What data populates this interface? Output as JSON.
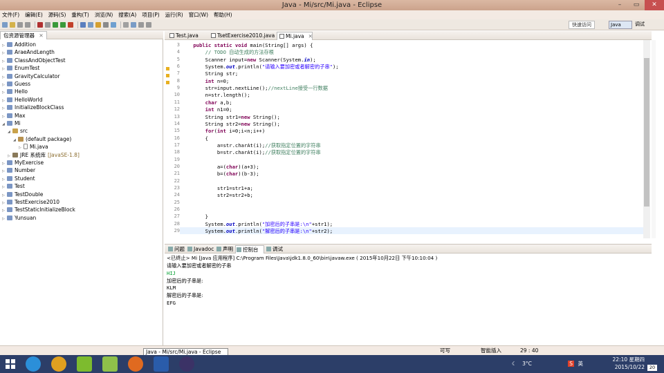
{
  "window": {
    "title": "Java - Mi/src/Mi.java - Eclipse"
  },
  "menu": [
    "文件(F)",
    "编辑(E)",
    "源码(S)",
    "重构(T)",
    "浏览(N)",
    "搜索(A)",
    "项目(P)",
    "运行(R)",
    "窗口(W)",
    "帮助(H)"
  ],
  "toolbar": {
    "quick_access": "快速访问",
    "perspectives": [
      "Java",
      "调试"
    ]
  },
  "explorer": {
    "title": "包资源管理器",
    "items": [
      {
        "label": "Addition",
        "level": 0,
        "twisty": "▷"
      },
      {
        "label": "AraeAndLength",
        "level": 0,
        "twisty": "▷"
      },
      {
        "label": "ClassAndObjectTest",
        "level": 0,
        "twisty": "▷"
      },
      {
        "label": "EnumTest",
        "level": 0,
        "twisty": "▷"
      },
      {
        "label": "GravityCalculator",
        "level": 0,
        "twisty": "▷"
      },
      {
        "label": "Guess",
        "level": 0,
        "twisty": "▷"
      },
      {
        "label": "Hello",
        "level": 0,
        "twisty": "▷"
      },
      {
        "label": "HelloWorld",
        "level": 0,
        "twisty": "▷"
      },
      {
        "label": "InitializeBlockClass",
        "level": 0,
        "twisty": "▷"
      },
      {
        "label": "Max",
        "level": 0,
        "twisty": "▷"
      },
      {
        "label": "Mi",
        "level": 0,
        "twisty": "◢"
      },
      {
        "label": "src",
        "level": 1,
        "twisty": "◢",
        "kind": "src"
      },
      {
        "label": "(default package)",
        "level": 2,
        "twisty": "◢",
        "kind": "pkg"
      },
      {
        "label": "Mi.java",
        "level": 3,
        "twisty": "▷",
        "kind": "file"
      },
      {
        "label": "JRE 系统库",
        "level": 1,
        "twisty": "▷",
        "kind": "lib",
        "decoration": "[JavaSE-1.8]"
      },
      {
        "label": "MyExercise",
        "level": 0,
        "twisty": "▷"
      },
      {
        "label": "Number",
        "level": 0,
        "twisty": "▷"
      },
      {
        "label": "Student",
        "level": 0,
        "twisty": "▷"
      },
      {
        "label": "Test",
        "level": 0,
        "twisty": "▷"
      },
      {
        "label": "TestDouble",
        "level": 0,
        "twisty": "▷"
      },
      {
        "label": "TestExercise2010",
        "level": 0,
        "twisty": "▷"
      },
      {
        "label": "TestStaticInitializeBlock",
        "level": 0,
        "twisty": "▷"
      },
      {
        "label": "Yunsuan",
        "level": 0,
        "twisty": "▷"
      }
    ]
  },
  "editor": {
    "tabs": [
      "Test.java",
      "TsetExercise2010.java",
      "Mi.java"
    ],
    "active_tab": 2,
    "cursor_line": 29,
    "lines": [
      {
        "n": "3",
        "html": "    <span class=\"kw\">public</span> <span class=\"kw\">static</span> <span class=\"kw\">void</span> main(String[] args) {"
      },
      {
        "n": "4",
        "html": "        <span class=\"cm\">// TODO 自动生成的方法存根</span>"
      },
      {
        "n": "5",
        "html": "        Scanner input=<span class=\"kw\">new</span> Scanner(System.<span class=\"fd\">in</span>);"
      },
      {
        "n": "6",
        "html": "        System.<span class=\"fd\">out</span>.println(<span class=\"st\">\"请输入要加密或者解密的子串\"</span>);"
      },
      {
        "n": "7",
        "html": "        String str;"
      },
      {
        "n": "8",
        "html": "        <span class=\"kw\">int</span> n=0;"
      },
      {
        "n": "9",
        "html": "        str=input.nextLine();<span class=\"cm\">//nextLine接受一行数据</span>"
      },
      {
        "n": "10",
        "html": "        n=str.length();"
      },
      {
        "n": "11",
        "html": "        <span class=\"kw\">char</span> a,b;"
      },
      {
        "n": "12",
        "html": "        <span class=\"kw\">int</span> n1=0;"
      },
      {
        "n": "13",
        "html": "        String str1=<span class=\"kw\">new</span> String();"
      },
      {
        "n": "14",
        "html": "        String str2=<span class=\"kw\">new</span> String();"
      },
      {
        "n": "15",
        "html": "        <span class=\"kw\">for</span>(<span class=\"kw\">int</span> i=0;i&lt;n;i++)"
      },
      {
        "n": "16",
        "html": "        {"
      },
      {
        "n": "17",
        "html": "            a=str.charAt(i);<span class=\"cm\">//获取指定位置的字符串</span>"
      },
      {
        "n": "18",
        "html": "            b=str.charAt(i);<span class=\"cm\">//获取指定位置的字符串</span>"
      },
      {
        "n": "19",
        "html": ""
      },
      {
        "n": "20",
        "html": "            a=(<span class=\"kw\">char</span>)(a+3);"
      },
      {
        "n": "21",
        "html": "            b=(<span class=\"kw\">char</span>)(b-3);"
      },
      {
        "n": "22",
        "html": ""
      },
      {
        "n": "23",
        "html": "            str1=str1+a;"
      },
      {
        "n": "24",
        "html": "            str2=str2+b;"
      },
      {
        "n": "25",
        "html": ""
      },
      {
        "n": "26",
        "html": ""
      },
      {
        "n": "27",
        "html": "        }"
      },
      {
        "n": "28",
        "html": "        System.<span class=\"fd\">out</span>.println(<span class=\"st\">\"加密后的子串是:\\n\"</span>+str1);"
      },
      {
        "n": "29",
        "html": "        System.<span class=\"fd\">out</span>.println(<span class=\"st\">\"解密后的子串是:\\n\"</span>+str2);"
      }
    ]
  },
  "console": {
    "tabs": [
      "问题",
      "Javadoc",
      "声明",
      "控制台",
      "调试"
    ],
    "active_tab": 3,
    "header": "<已终止> Mi [Java 应用程序] C:\\Program Files\\Java\\jdk1.8.0_60\\bin\\javaw.exe ( 2015年10月22日 下午10:10:04 )",
    "lines": [
      {
        "text": "请输入要加密或者解密的子串",
        "kind": "out"
      },
      {
        "text": "HIJ",
        "kind": "input"
      },
      {
        "text": "加密后的子串是:",
        "kind": "out"
      },
      {
        "text": "KLM",
        "kind": "mono"
      },
      {
        "text": "解密后的子串是:",
        "kind": "out"
      },
      {
        "text": "EFG",
        "kind": "mono"
      }
    ]
  },
  "status": {
    "writable": "可写",
    "insert_mode": "智能插入",
    "position": "29 : 40"
  },
  "tooltip": "Java - Mi/src/Mi.java - Eclipse",
  "taskbar": {
    "weather": "3°C",
    "ime": "英",
    "time": "22:10 星期四",
    "date": "2015/10/22",
    "badge": "20",
    "apps": [
      {
        "name": "ie",
        "color": "#2b8fd9"
      },
      {
        "name": "chrome",
        "color": "#e0a020"
      },
      {
        "name": "iqiyi",
        "color": "#7dbb2e"
      },
      {
        "name": "android",
        "color": "#8fc04a"
      },
      {
        "name": "firefox",
        "color": "#e06a20"
      },
      {
        "name": "word",
        "color": "#2a5caa"
      },
      {
        "name": "eclipse",
        "color": "#3b3266"
      }
    ]
  }
}
